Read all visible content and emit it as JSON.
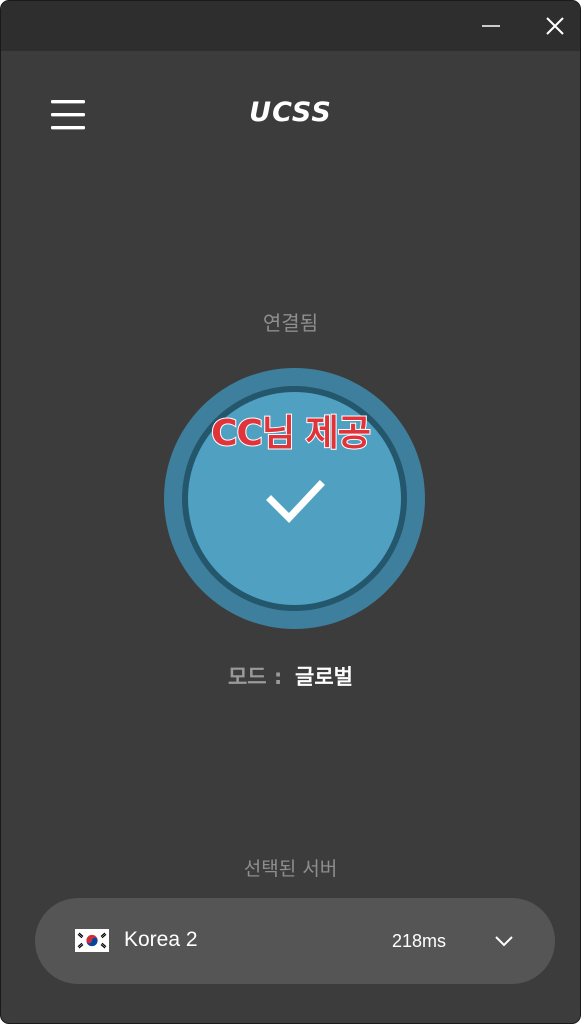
{
  "app": {
    "logo_text": "UCSS"
  },
  "titlebar": {
    "minimize_icon": "minimize-icon",
    "close_icon": "close-icon"
  },
  "header": {
    "menu_icon": "hamburger-menu-icon"
  },
  "connection": {
    "status": "연결됨",
    "watermark": "CC님 제공",
    "state_icon": "checkmark-icon",
    "ring_color": "#3d7f9c",
    "core_color": "#4fa0c1"
  },
  "mode": {
    "label": "모드 :",
    "value": "글로벌"
  },
  "server": {
    "caption": "선택된 서버",
    "flag_icon": "south-korea-flag-icon",
    "name": "Korea 2",
    "latency": "218ms",
    "dropdown_icon": "chevron-down-icon"
  },
  "colors": {
    "background": "#3c3c3c",
    "titlebar": "#2e2e2e",
    "server_pill": "#555555",
    "watermark_red": "#e0343a"
  }
}
